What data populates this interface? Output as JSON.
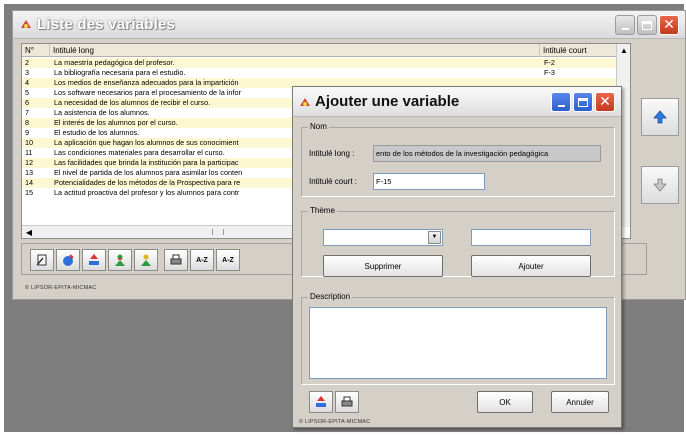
{
  "main_window": {
    "title": "Liste des variables",
    "columns": {
      "num": "N°",
      "long": "Intitulé long",
      "short": "Intitulé court"
    },
    "rows": [
      {
        "num": "2",
        "long": "La maestría pedagógica del profesor.",
        "short": "F-2"
      },
      {
        "num": "3",
        "long": "La bibliografía necesaria para el estudio.",
        "short": "F-3"
      },
      {
        "num": "4",
        "long": "Los medios de enseñanza adecuados para la impartición",
        "short": ""
      },
      {
        "num": "5",
        "long": "Los software necesarios para el procesamiento de la infor",
        "short": ""
      },
      {
        "num": "6",
        "long": "La necesidad de los alumnos de recibir el curso.",
        "short": ""
      },
      {
        "num": "7",
        "long": "La asistencia de los alumnos.",
        "short": ""
      },
      {
        "num": "8",
        "long": "El interés de los alumnos por el curso.",
        "short": ""
      },
      {
        "num": "9",
        "long": "El estudio de los alumnos.",
        "short": ""
      },
      {
        "num": "10",
        "long": "La aplicación que hagan los alumnos de sus conocimient",
        "short": ""
      },
      {
        "num": "11",
        "long": "Las condiciones materiales para desarrollar el curso.",
        "short": ""
      },
      {
        "num": "12",
        "long": "Las facilidades que brinda la institución para la participac",
        "short": ""
      },
      {
        "num": "13",
        "long": "El nivel de partida de los alumnos para asimilar los conten",
        "short": ""
      },
      {
        "num": "14",
        "long": "Potencialidades de los métodos de la Prospectiva para re",
        "short": ""
      },
      {
        "num": "15",
        "long": "La actitud proactiva del profesor y los alumnos para contr",
        "short": ""
      }
    ],
    "toolbar": {
      "sort_az_1": "A-Z",
      "sort_az_2": "A-Z"
    },
    "copyright": "© LIPSOR-EPITA-MICMAC"
  },
  "dialog": {
    "title": "Ajouter une variable",
    "nom_group": "Nom",
    "long_label": "Intitulé long :",
    "long_value": "ento de los métodos de la investigación pedagógica",
    "short_label": "Intitulé court :",
    "short_value": "F-15",
    "theme_group": "Thème",
    "theme_select_value": "",
    "theme_text_value": "",
    "supprimer": "Supprimer",
    "ajouter": "Ajouter",
    "description_group": "Description",
    "description_value": "",
    "ok": "OK",
    "annuler": "Annuler",
    "copyright": "© LIPSOR-EPITA-MICMAC"
  },
  "colors": {
    "row_highlight": "#fdf8d2",
    "close_red": "#d44a2e",
    "active_blue": "#3a6ee0",
    "arrow_blue": "#2a7be0"
  }
}
